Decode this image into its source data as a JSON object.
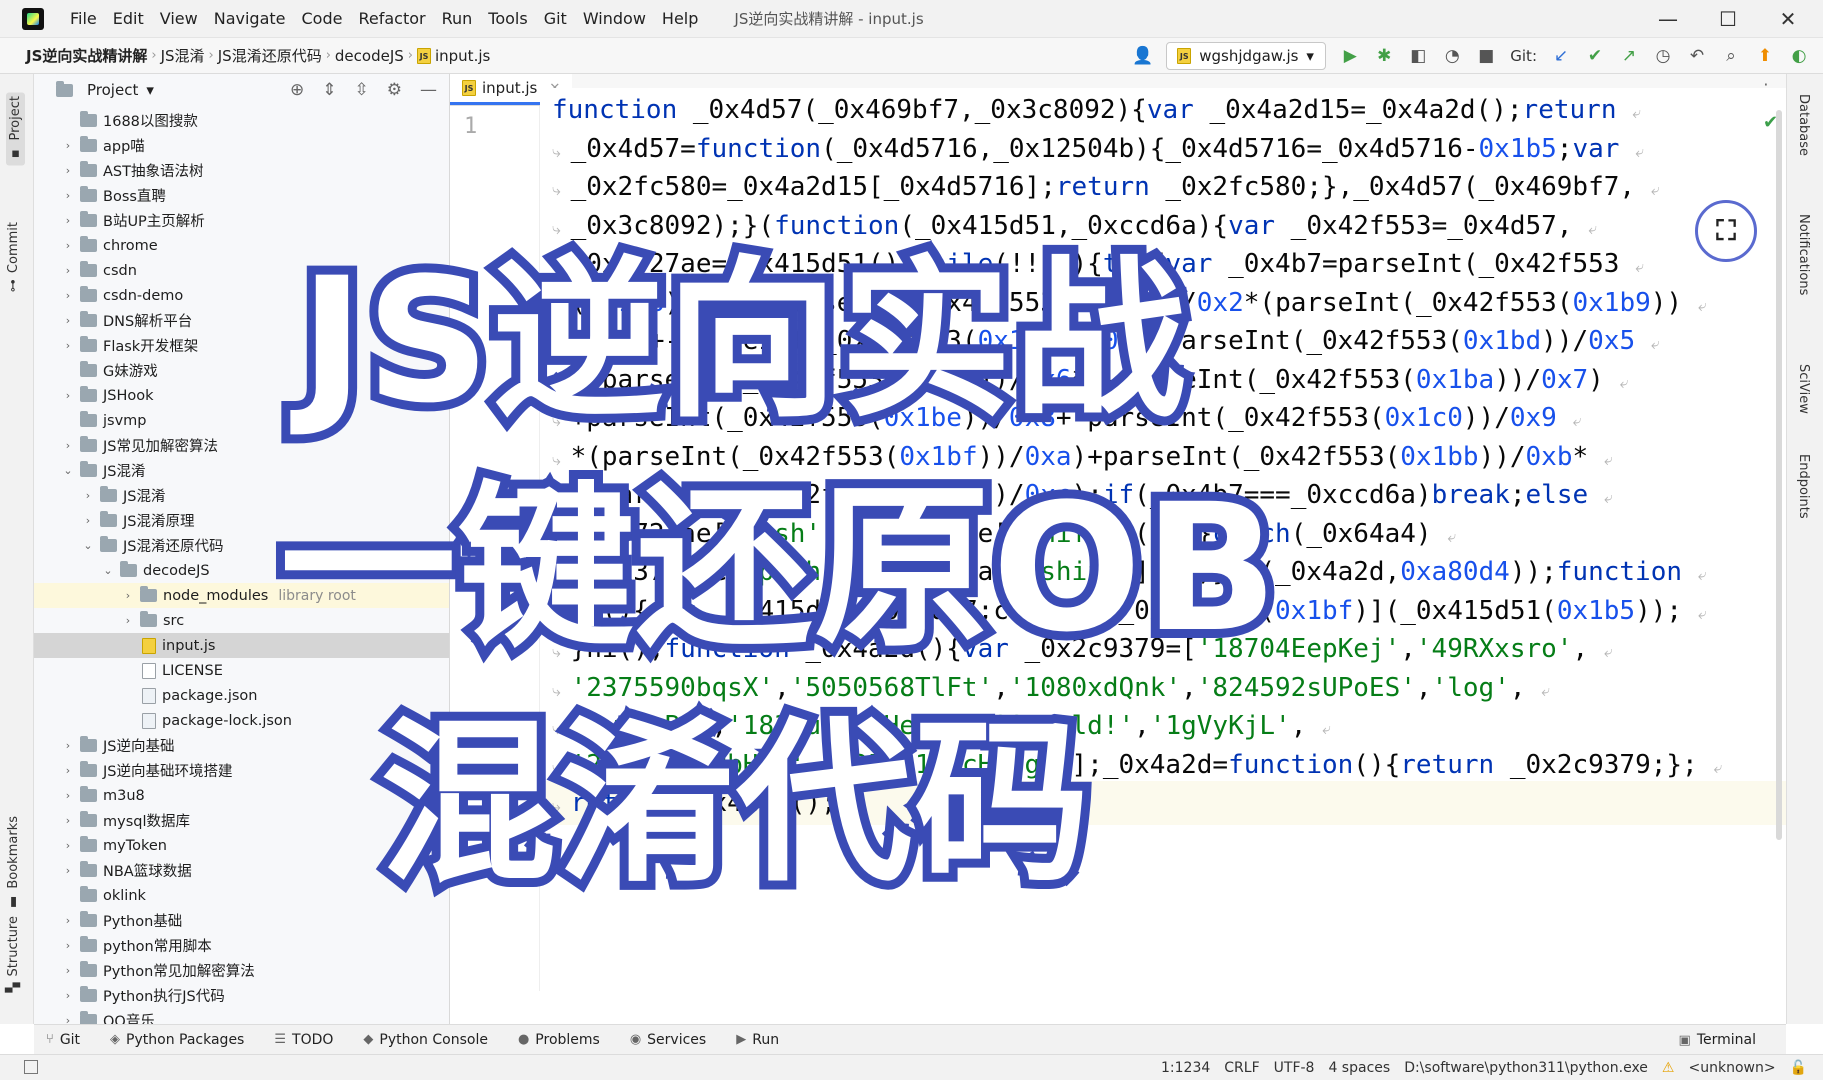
{
  "menubar": {
    "items": [
      "File",
      "Edit",
      "View",
      "Navigate",
      "Code",
      "Refactor",
      "Run",
      "Tools",
      "Git",
      "Window",
      "Help"
    ],
    "window_title": "JS逆向实战精讲解 - input.js",
    "controls": [
      "—",
      "☐",
      "✕"
    ]
  },
  "navbar": {
    "breadcrumbs": [
      "JS逆向实战精讲解",
      "JS混淆",
      "JS混淆还原代码",
      "decodeJS",
      "input.js"
    ],
    "run_config": "wgshjdgaw.js",
    "git_label": "Git:"
  },
  "left_strip": {
    "project_tab": "Project",
    "commit_tab": "Commit",
    "bookmarks_tab": "Bookmarks",
    "structure_tab": "Structure"
  },
  "project_panel": {
    "title": "Project",
    "tree": [
      {
        "label": "1688以图搜款",
        "indent": 0,
        "arrow": "",
        "type": "folder"
      },
      {
        "label": "app喵",
        "indent": 0,
        "arrow": "›",
        "type": "folder"
      },
      {
        "label": "AST抽象语法树",
        "indent": 0,
        "arrow": "›",
        "type": "folder"
      },
      {
        "label": "Boss直聘",
        "indent": 0,
        "arrow": "›",
        "type": "folder"
      },
      {
        "label": "B站UP主页解析",
        "indent": 0,
        "arrow": "›",
        "type": "folder"
      },
      {
        "label": "chrome",
        "indent": 0,
        "arrow": "›",
        "type": "folder"
      },
      {
        "label": "csdn",
        "indent": 0,
        "arrow": "›",
        "type": "folder"
      },
      {
        "label": "csdn-demo",
        "indent": 0,
        "arrow": "›",
        "type": "folder"
      },
      {
        "label": "DNS解析平台",
        "indent": 0,
        "arrow": "›",
        "type": "folder"
      },
      {
        "label": "Flask开发框架",
        "indent": 0,
        "arrow": "›",
        "type": "folder"
      },
      {
        "label": "G妹游戏",
        "indent": 0,
        "arrow": "",
        "type": "folder"
      },
      {
        "label": "JSHook",
        "indent": 0,
        "arrow": "›",
        "type": "folder"
      },
      {
        "label": "jsvmp",
        "indent": 0,
        "arrow": "",
        "type": "folder"
      },
      {
        "label": "JS常见加解密算法",
        "indent": 0,
        "arrow": "›",
        "type": "folder"
      },
      {
        "label": "JS混淆",
        "indent": 0,
        "arrow": "⌄",
        "type": "folder"
      },
      {
        "label": "JS混淆",
        "indent": 1,
        "arrow": "›",
        "type": "folder"
      },
      {
        "label": "JS混淆原理",
        "indent": 1,
        "arrow": "›",
        "type": "folder"
      },
      {
        "label": "JS混淆还原代码",
        "indent": 1,
        "arrow": "⌄",
        "type": "folder"
      },
      {
        "label": "decodeJS",
        "indent": 2,
        "arrow": "⌄",
        "type": "folder"
      },
      {
        "label": "node_modules",
        "indent": 3,
        "arrow": "›",
        "type": "folder",
        "hint": "library root",
        "row": "lib"
      },
      {
        "label": "src",
        "indent": 3,
        "arrow": "›",
        "type": "folder"
      },
      {
        "label": "input.js",
        "indent": 3,
        "arrow": "",
        "type": "js",
        "row": "selected"
      },
      {
        "label": "LICENSE",
        "indent": 3,
        "arrow": "",
        "type": "file"
      },
      {
        "label": "package.json",
        "indent": 3,
        "arrow": "",
        "type": "json"
      },
      {
        "label": "package-lock.json",
        "indent": 3,
        "arrow": "",
        "type": "json"
      },
      {
        "label": "JS逆向基础",
        "indent": 0,
        "arrow": "›",
        "type": "folder"
      },
      {
        "label": "JS逆向基础环境搭建",
        "indent": 0,
        "arrow": "›",
        "type": "folder"
      },
      {
        "label": "m3u8",
        "indent": 0,
        "arrow": "›",
        "type": "folder"
      },
      {
        "label": "mysql数据库",
        "indent": 0,
        "arrow": "›",
        "type": "folder"
      },
      {
        "label": "myToken",
        "indent": 0,
        "arrow": "›",
        "type": "folder"
      },
      {
        "label": "NBA篮球数据",
        "indent": 0,
        "arrow": "›",
        "type": "folder"
      },
      {
        "label": "oklink",
        "indent": 0,
        "arrow": "",
        "type": "folder"
      },
      {
        "label": "Python基础",
        "indent": 0,
        "arrow": "›",
        "type": "folder"
      },
      {
        "label": "python常用脚本",
        "indent": 0,
        "arrow": "›",
        "type": "folder"
      },
      {
        "label": "Python常见加解密算法",
        "indent": 0,
        "arrow": "›",
        "type": "folder"
      },
      {
        "label": "Python执行JS代码",
        "indent": 0,
        "arrow": "›",
        "type": "folder"
      },
      {
        "label": "QQ音乐",
        "indent": 0,
        "arrow": "›",
        "type": "folder"
      }
    ]
  },
  "editor": {
    "tab_label": "input.js",
    "line_number": "1",
    "code_lines": [
      "function _0x4d57(_0x469bf7,_0x3c8092){var _0x4a2d15=_0x4a2d();return",
      "_0x4d57=function(_0x4d5716,_0x12504b){_0x4d5716=_0x4d5716-0x1b5;var",
      "_0x2fc580=_0x4a2d15[_0x4d5716];return _0x2fc580;},_0x4d57(_0x469bf7,",
      "_0x3c8092);}(function(_0x415d51,_0xccd6a){var _0x42f553=_0x4d57,",
      "_0x3727ae=_0x415d51();while(!![]){try{var _0x4b7=parseInt(_0x42f553",
      "(0x1b6))/0x1+parseInt(_0x42f553(0x1b7))/0x2*(parseInt(_0x42f553(0x1b9))",
      "/0x3)+-parseInt(_0x42f553(0x1b8))/0x4+parseInt(_0x42f553(0x1bd))/0x5",
      "+-parseInt(_0x42f553(0x1bc))/0x6*(-parseInt(_0x42f553(0x1ba))/0x7)",
      "+parseInt(_0x42f553(0x1be))/0x8+-parseInt(_0x42f553(0x1c0))/0x9",
      "*(parseInt(_0x42f553(0x1bf))/0xa)+parseInt(_0x42f553(0x1bb))/0xb*",
      "(-parseInt(_0x42f553(0x1c1))/0xc);if(_0x4b7===_0xccd6a)break;else",
      "_0x3727ae['push'](_0x3727ae['shift']());}catch(_0x64a4)",
      "{_0x3727ae['push'](_0x3727ae['shift']());}}}(_0x4a2d,0xa80d4));function",
      "hi(){var _0x415d51=_0x4d57;console[_0x415d51(0x1bf)](_0x415d51(0x1b5));",
      "}hi();function _0x4a2d(){var _0x2c9379=['18704EepKej','49RXxsro',",
      "'2375590bqsX','5050568TlFt','1080xdQnk','824592sUPoES','log',",
      "'6wdGgBi','183iuo','Hello\\x20World!','1gVyKjL',",
      "'2241648YBbHmz','12546160cHhogN'];_0x4a2d=function(){return _0x2c9379;};",
      "return _0x4a2d();}"
    ]
  },
  "overlay": {
    "line1": "JS逆向实战",
    "line2": "一键还原OB",
    "line3": "混淆代码"
  },
  "right_strip": {
    "tabs": [
      "Database",
      "Notifications",
      "SciView",
      "Endpoints"
    ]
  },
  "bottom_tabs": [
    "Git",
    "Python Packages",
    "TODO",
    "Python Console",
    "Problems",
    "Services",
    "Run"
  ],
  "terminal_tab": "Terminal",
  "statusbar": {
    "position": "1:1234",
    "line_sep": "CRLF",
    "encoding": "UTF-8",
    "indent": "4 spaces",
    "interpreter": "D:\\software\\python311\\python.exe",
    "vcs": "<unknown>"
  }
}
